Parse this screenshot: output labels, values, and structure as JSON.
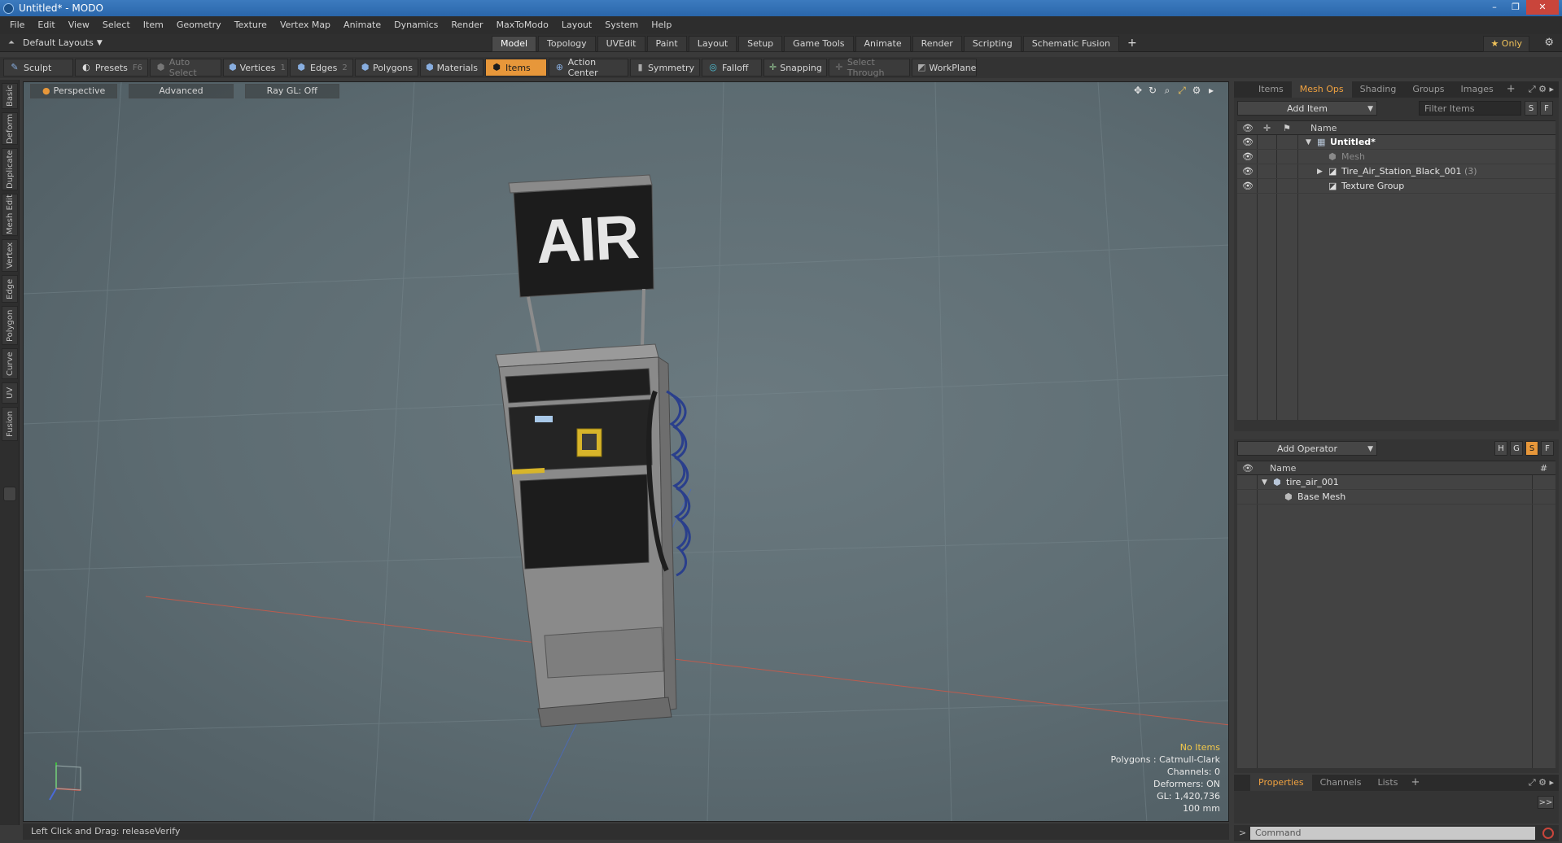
{
  "window": {
    "title": "Untitled* - MODO",
    "controls": {
      "minimize": "–",
      "maximize": "❐",
      "close": "✕"
    }
  },
  "menubar": {
    "items": [
      "File",
      "Edit",
      "View",
      "Select",
      "Item",
      "Geometry",
      "Texture",
      "Vertex Map",
      "Animate",
      "Dynamics",
      "Render",
      "MaxToModo",
      "Layout",
      "System",
      "Help"
    ]
  },
  "layoutbar": {
    "layout_label": "Default Layouts",
    "tabs": [
      "Model",
      "Topology",
      "UVEdit",
      "Paint",
      "Layout",
      "Setup",
      "Game Tools",
      "Animate",
      "Render",
      "Scripting",
      "Schematic Fusion"
    ],
    "active_tab": "Model",
    "add_label": "+",
    "only_label": "★ Only"
  },
  "toolbar": {
    "sculpt": "Sculpt",
    "presets": "Presets",
    "presets_key": "F6",
    "auto_select": "Auto Select",
    "vertices": "Vertices",
    "vertices_key": "1",
    "edges": "Edges",
    "edges_key": "2",
    "polygons": "Polygons",
    "materials": "Materials",
    "items": "Items",
    "action_center": "Action Center",
    "symmetry": "Symmetry",
    "falloff": "Falloff",
    "snapping": "Snapping",
    "select_through": "Select Through",
    "workplane": "WorkPlane"
  },
  "left_tabs": [
    "Basic",
    "Deform",
    "Duplicate",
    "Mesh Edit",
    "Vertex",
    "Edge",
    "Polygon",
    "Curve",
    "UV",
    "Fusion"
  ],
  "viewport": {
    "view_mode": "Perspective",
    "shading": "Advanced",
    "raygl": "Ray GL: Off",
    "sign_text": "AIR",
    "info": {
      "selection": "No Items",
      "polygons": "Polygons : Catmull-Clark",
      "channels": "Channels: 0",
      "deformers": "Deformers: ON",
      "gl": "GL: 1,420,736",
      "unit": "100 mm"
    }
  },
  "statusbar": {
    "text": "Left Click and Drag:   releaseVerify"
  },
  "item_panel": {
    "tabs": [
      "Items",
      "Mesh Ops",
      "Shading",
      "Groups",
      "Images"
    ],
    "active_tab": "Mesh Ops",
    "add_item": "Add Item",
    "filter_placeholder": "Filter Items",
    "btn_s": "S",
    "btn_f": "F",
    "name_header": "Name",
    "rows": [
      {
        "label": "Untitled*",
        "count": ""
      },
      {
        "label": "Mesh",
        "count": ""
      },
      {
        "label": "Tire_Air_Station_Black_001",
        "count": "(3)"
      },
      {
        "label": "Texture Group",
        "count": ""
      }
    ]
  },
  "operator_panel": {
    "add_operator": "Add Operator",
    "btn_h": "H",
    "btn_g": "G",
    "btn_s": "S",
    "btn_f": "F",
    "name_header": "Name",
    "hash_header": "#",
    "rows": [
      {
        "label": "tire_air_001"
      },
      {
        "label": "Base Mesh"
      }
    ]
  },
  "props_panel": {
    "tabs": [
      "Properties",
      "Channels",
      "Lists"
    ],
    "active_tab": "Properties",
    "expand": ">>"
  },
  "command": {
    "prompt": ">",
    "placeholder": "Command"
  }
}
